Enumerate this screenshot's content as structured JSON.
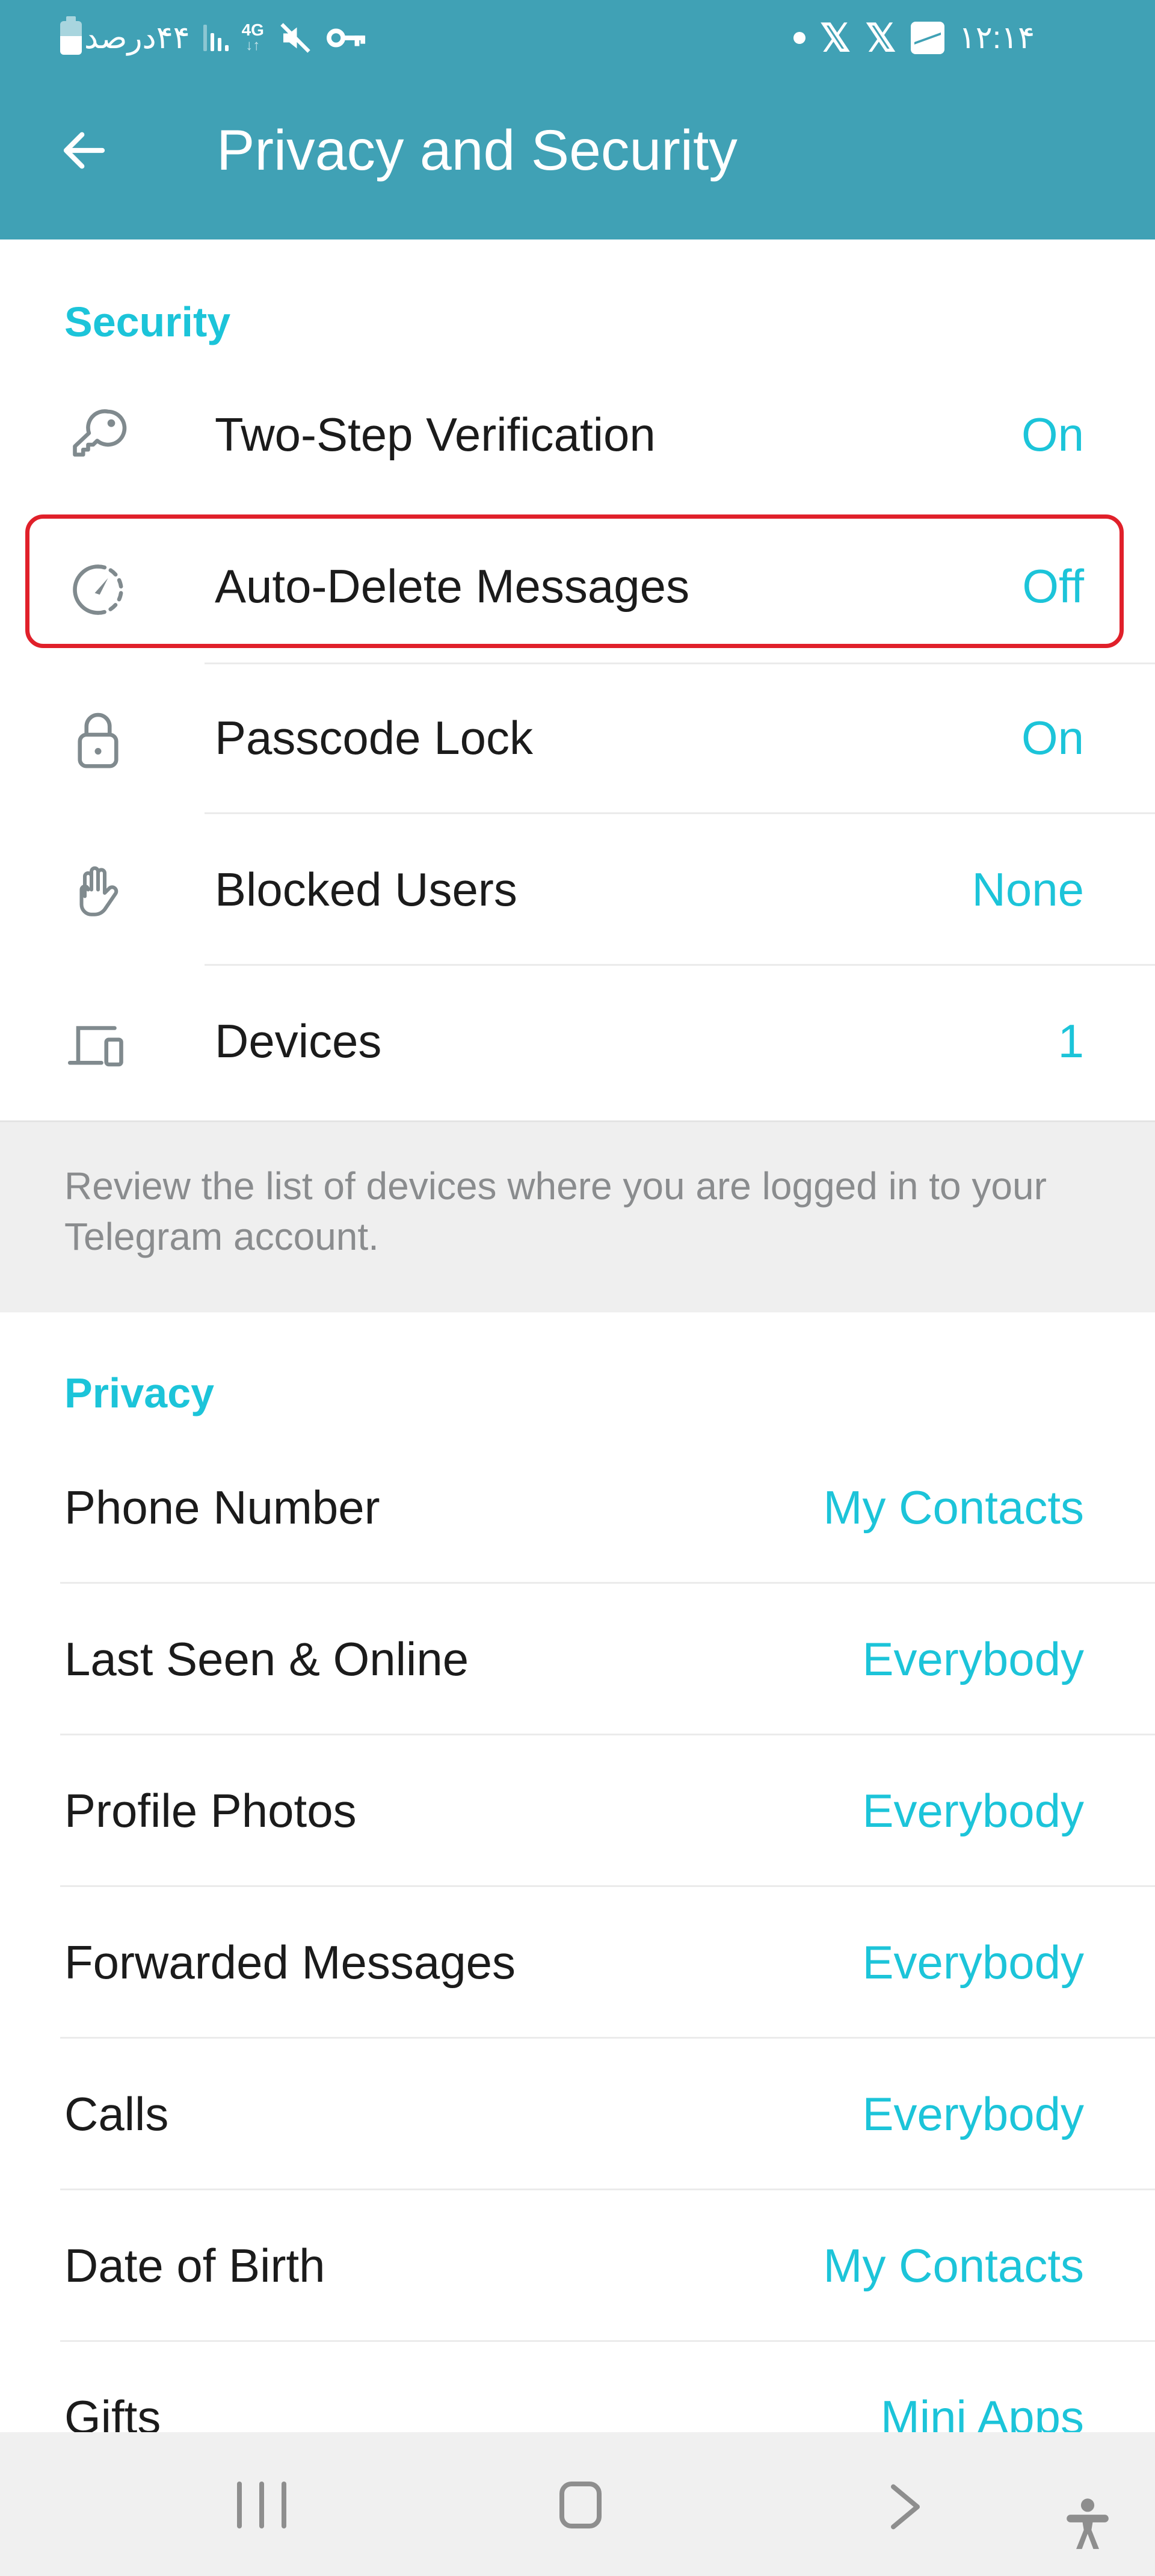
{
  "status_bar": {
    "battery_text": "۴۴درصد",
    "battery_percent": 44,
    "network": "4G",
    "time": "۱۲:۱۴",
    "left_icons": [
      "battery-icon",
      "signal-icon",
      "network-4g-icon",
      "mute-icon",
      "vpn-key-icon"
    ],
    "right_icons": [
      "notification-dot-icon",
      "x-app-icon",
      "x-app-icon",
      "gallery-icon"
    ]
  },
  "app_bar": {
    "title": "Privacy and Security",
    "back_icon": "arrow-left-icon"
  },
  "security": {
    "header": "Security",
    "items": [
      {
        "label": "Two-Step Verification",
        "value": "On",
        "icon": "key-icon"
      },
      {
        "label": "Auto-Delete Messages",
        "value": "Off",
        "icon": "timer-icon",
        "highlighted": true
      },
      {
        "label": "Passcode Lock",
        "value": "On",
        "icon": "lock-icon"
      },
      {
        "label": "Blocked Users",
        "value": "None",
        "icon": "hand-icon"
      },
      {
        "label": "Devices",
        "value": "1",
        "icon": "devices-icon"
      }
    ],
    "footer": "Review the list of devices where you are logged in to your Telegram account."
  },
  "privacy": {
    "header": "Privacy",
    "items": [
      {
        "label": "Phone Number",
        "value": "My Contacts"
      },
      {
        "label": "Last Seen & Online",
        "value": "Everybody"
      },
      {
        "label": "Profile Photos",
        "value": "Everybody"
      },
      {
        "label": "Forwarded Messages",
        "value": "Everybody"
      },
      {
        "label": "Calls",
        "value": "Everybody"
      },
      {
        "label": "Date of Birth",
        "value": "My Contacts"
      },
      {
        "label": "Gifts",
        "value": "Mini Apps"
      }
    ]
  },
  "nav_bar": {
    "buttons": [
      "recent-apps",
      "home",
      "back",
      "accessibility"
    ]
  },
  "colors": {
    "header_bg": "#40a1b5",
    "accent": "#1cc4d9",
    "highlight_border": "#e0202a",
    "icon_gray": "#808a8e",
    "info_bg": "#efefef"
  }
}
